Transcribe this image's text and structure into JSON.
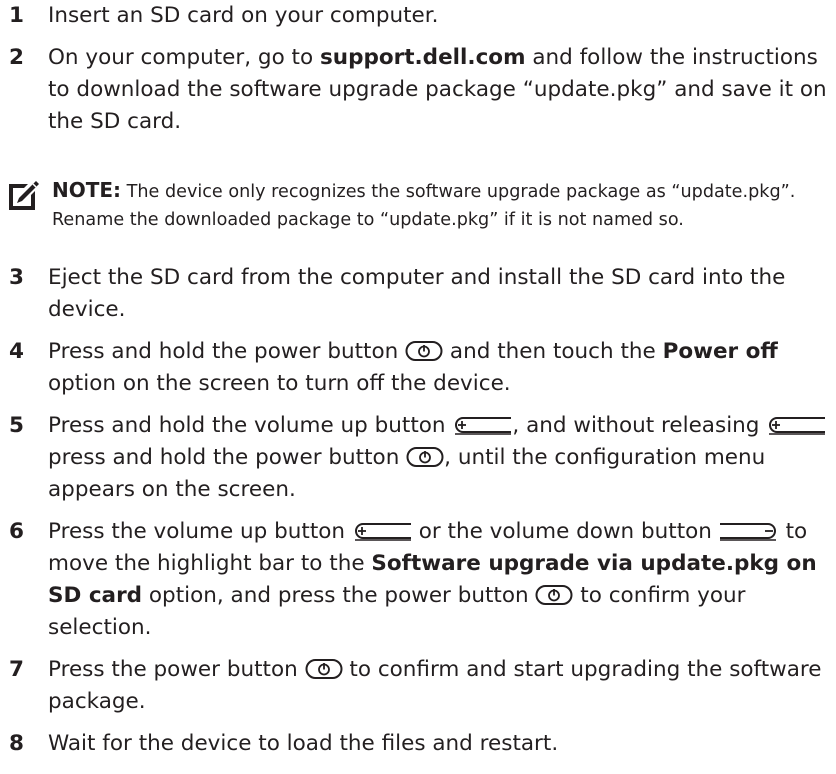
{
  "steps": [
    {
      "num": "1",
      "t1": "Insert an SD card on your computer."
    },
    {
      "num": "2",
      "t1": "On your computer, go to ",
      "b1": "support.dell.com",
      "t2": " and follow the instructions to download the software upgrade package “update.pkg” and save it on the SD card."
    },
    {
      "num": "3",
      "t1": "Eject the SD card from the computer and install the SD card into the device."
    },
    {
      "num": "4",
      "t1": "Press and hold the power button ",
      "t2": " and then touch the ",
      "b1": "Power off",
      "t3": " option on the screen to turn off the device."
    },
    {
      "num": "5",
      "t1": "Press and hold the volume up button ",
      "t2": ", and without releasing ",
      "t3": " press and hold the power button ",
      "t4": ", until the configuration menu appears on the screen."
    },
    {
      "num": "6",
      "t1": "Press the volume up button ",
      "t2": " or the volume down button ",
      "t3": " to move the highlight bar to the ",
      "b1": "Software upgrade via update.pkg on SD card",
      "t4": " option, and press the power button ",
      "t5": " to confirm your selection."
    },
    {
      "num": "7",
      "t1": "Press the power button ",
      "t2": " to confirm and start upgrading the software package."
    },
    {
      "num": "8",
      "t1": "Wait for the device to load the files and restart."
    }
  ],
  "note": {
    "label": "NOTE:",
    "text": " The device only recognizes the software upgrade package as “update.pkg”. Rename the downloaded package to “update.pkg” if it is not named so."
  },
  "icons": {
    "note": "pencil-note-icon",
    "power": "power-button-icon",
    "volume_up": "volume-up-button-icon",
    "volume_down": "volume-down-button-icon"
  }
}
